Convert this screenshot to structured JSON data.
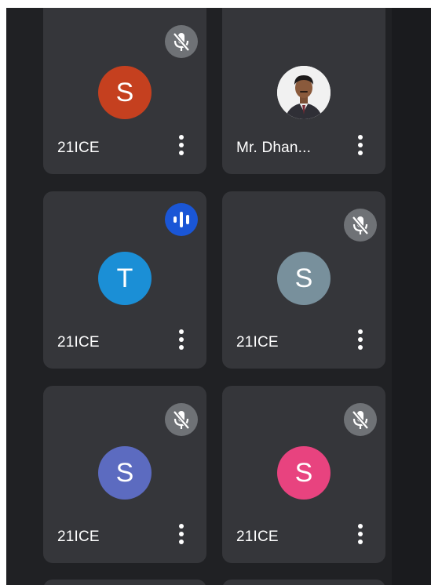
{
  "participants": [
    {
      "name": "21ICE",
      "initial": "S",
      "avatar_color": "#c5401f",
      "muted": true,
      "speaking": false
    },
    {
      "name": "Mr. Dhan...",
      "initial": "",
      "avatar_color": "#f3f3f3",
      "muted": false,
      "speaking": false,
      "has_photo": true
    },
    {
      "name": "21ICE",
      "initial": "T",
      "avatar_color": "#1b8fd6",
      "muted": false,
      "speaking": true
    },
    {
      "name": "21ICE",
      "initial": "S",
      "avatar_color": "#78909c",
      "muted": true,
      "speaking": false
    },
    {
      "name": "21ICE",
      "initial": "S",
      "avatar_color": "#5c6bc0",
      "muted": true,
      "speaking": false
    },
    {
      "name": "21ICE",
      "initial": "S",
      "avatar_color": "#e8437f",
      "muted": true,
      "speaking": false
    }
  ],
  "icons": {
    "mute": "mic-off-icon",
    "speaking": "audio-wave-icon",
    "more": "more-vert-icon"
  },
  "colors": {
    "background": "#202124",
    "tile": "#35363a",
    "mute_badge": "#6f7276",
    "speaking_badge": "#1a56d6"
  }
}
